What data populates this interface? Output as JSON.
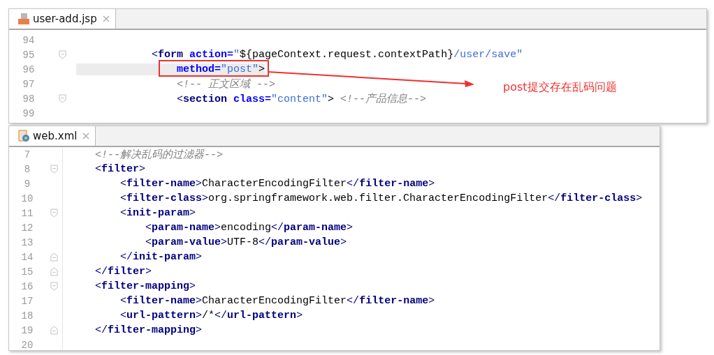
{
  "editors": [
    {
      "tab": {
        "label": "user-add.jsp",
        "selected": true
      },
      "lines": [
        {
          "number": "94",
          "kind": "plain"
        },
        {
          "number": "95",
          "kind": "fold-start",
          "tokens": [
            {
              "kind": "punct",
              "text": "            <"
            },
            {
              "kind": "tag",
              "text": "form"
            },
            {
              "kind": "attr",
              "text": " action="
            },
            {
              "kind": "value",
              "text": "\""
            },
            {
              "kind": "text",
              "text": "${pageContext.request.contextPath}"
            },
            {
              "kind": "value",
              "text": "/user/save\""
            }
          ]
        },
        {
          "number": "96",
          "kind": "plain",
          "highlighted": true,
          "tokens": [
            {
              "kind": "attr",
              "text": "                method="
            },
            {
              "kind": "value",
              "text": "\"post\""
            },
            {
              "kind": "text",
              "text": ">"
            }
          ]
        },
        {
          "number": "97",
          "kind": "plain",
          "tokens": [
            {
              "kind": "comment",
              "text": "                <!-- 正文区域 -->"
            }
          ]
        },
        {
          "number": "98",
          "kind": "fold-start",
          "tokens": [
            {
              "kind": "punct",
              "text": "                <"
            },
            {
              "kind": "tag",
              "text": "section"
            },
            {
              "kind": "attr",
              "text": " class="
            },
            {
              "kind": "value",
              "text": "\"content\""
            },
            {
              "kind": "text",
              "text": ">"
            },
            {
              "kind": "comment",
              "text": " <!--产品信息-->"
            }
          ]
        },
        {
          "number": "99",
          "kind": "plain"
        }
      ]
    },
    {
      "tab": {
        "label": "web.xml",
        "selected": true
      },
      "lines": [
        {
          "number": "7",
          "kind": "plain",
          "tokens": [
            {
              "kind": "comment",
              "text": "    <!--解决乱码的过滤器-->"
            }
          ]
        },
        {
          "number": "8",
          "kind": "fold-start",
          "tokens": [
            {
              "kind": "punct",
              "text": "    <"
            },
            {
              "kind": "tag",
              "text": "filter"
            },
            {
              "kind": "punct",
              "text": ">"
            }
          ]
        },
        {
          "number": "9",
          "kind": "plain",
          "tokens": [
            {
              "kind": "punct",
              "text": "        <"
            },
            {
              "kind": "tag",
              "text": "filter-name"
            },
            {
              "kind": "punct",
              "text": ">"
            },
            {
              "kind": "text",
              "text": "CharacterEncodingFilter"
            },
            {
              "kind": "punct",
              "text": "</"
            },
            {
              "kind": "tag",
              "text": "filter-name"
            },
            {
              "kind": "punct",
              "text": ">"
            }
          ]
        },
        {
          "number": "10",
          "kind": "plain",
          "tokens": [
            {
              "kind": "punct",
              "text": "        <"
            },
            {
              "kind": "tag",
              "text": "filter-class"
            },
            {
              "kind": "punct",
              "text": ">"
            },
            {
              "kind": "text",
              "text": "org.springframework.web.filter.CharacterEncodingFilter"
            },
            {
              "kind": "punct",
              "text": "</"
            },
            {
              "kind": "tag",
              "text": "filter-class"
            },
            {
              "kind": "punct",
              "text": ">"
            }
          ]
        },
        {
          "number": "11",
          "kind": "fold-start",
          "tokens": [
            {
              "kind": "punct",
              "text": "        <"
            },
            {
              "kind": "tag",
              "text": "init-param"
            },
            {
              "kind": "punct",
              "text": ">"
            }
          ]
        },
        {
          "number": "12",
          "kind": "plain",
          "tokens": [
            {
              "kind": "punct",
              "text": "            <"
            },
            {
              "kind": "tag",
              "text": "param-name"
            },
            {
              "kind": "punct",
              "text": ">"
            },
            {
              "kind": "text",
              "text": "encoding"
            },
            {
              "kind": "punct",
              "text": "</"
            },
            {
              "kind": "tag",
              "text": "param-name"
            },
            {
              "kind": "punct",
              "text": ">"
            }
          ]
        },
        {
          "number": "13",
          "kind": "plain",
          "tokens": [
            {
              "kind": "punct",
              "text": "            <"
            },
            {
              "kind": "tag",
              "text": "param-value"
            },
            {
              "kind": "punct",
              "text": ">"
            },
            {
              "kind": "text",
              "text": "UTF-8"
            },
            {
              "kind": "punct",
              "text": "</"
            },
            {
              "kind": "tag",
              "text": "param-value"
            },
            {
              "kind": "punct",
              "text": ">"
            }
          ]
        },
        {
          "number": "14",
          "kind": "fold-end",
          "tokens": [
            {
              "kind": "punct",
              "text": "        </"
            },
            {
              "kind": "tag",
              "text": "init-param"
            },
            {
              "kind": "punct",
              "text": ">"
            }
          ]
        },
        {
          "number": "15",
          "kind": "fold-end",
          "tokens": [
            {
              "kind": "punct",
              "text": "    </"
            },
            {
              "kind": "tag",
              "text": "filter"
            },
            {
              "kind": "punct",
              "text": ">"
            }
          ]
        },
        {
          "number": "16",
          "kind": "fold-start",
          "tokens": [
            {
              "kind": "punct",
              "text": "    <"
            },
            {
              "kind": "tag",
              "text": "filter-mapping"
            },
            {
              "kind": "punct",
              "text": ">"
            }
          ]
        },
        {
          "number": "17",
          "kind": "plain",
          "tokens": [
            {
              "kind": "punct",
              "text": "        <"
            },
            {
              "kind": "tag",
              "text": "filter-name"
            },
            {
              "kind": "punct",
              "text": ">"
            },
            {
              "kind": "text",
              "text": "CharacterEncodingFilter"
            },
            {
              "kind": "punct",
              "text": "</"
            },
            {
              "kind": "tag",
              "text": "filter-name"
            },
            {
              "kind": "punct",
              "text": ">"
            }
          ]
        },
        {
          "number": "18",
          "kind": "plain",
          "tokens": [
            {
              "kind": "punct",
              "text": "        <"
            },
            {
              "kind": "tag",
              "text": "url-pattern"
            },
            {
              "kind": "punct",
              "text": ">"
            },
            {
              "kind": "text",
              "text": "/*"
            },
            {
              "kind": "punct",
              "text": "</"
            },
            {
              "kind": "tag",
              "text": "url-pattern"
            },
            {
              "kind": "punct",
              "text": ">"
            }
          ]
        },
        {
          "number": "19",
          "kind": "fold-end",
          "tokens": [
            {
              "kind": "punct",
              "text": "    </"
            },
            {
              "kind": "tag",
              "text": "filter-mapping"
            },
            {
              "kind": "punct",
              "text": ">"
            }
          ]
        },
        {
          "number": "20",
          "kind": "plain"
        }
      ]
    }
  ],
  "annotation": {
    "note": "post提交存在乱码问题"
  }
}
